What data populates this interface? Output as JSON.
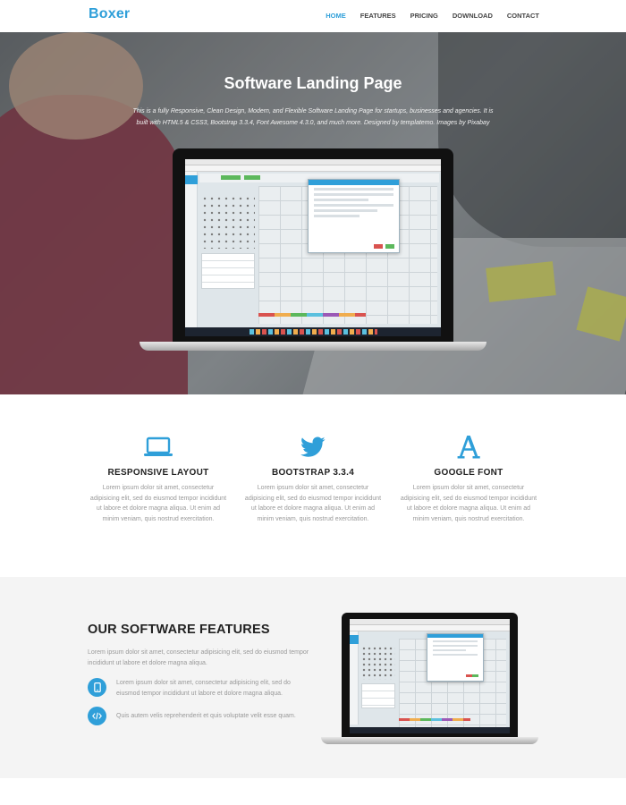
{
  "nav": {
    "brand": "Boxer",
    "links": [
      "HOME",
      "FEATURES",
      "PRICING",
      "DOWNLOAD",
      "CONTACT"
    ]
  },
  "hero": {
    "title": "Software Landing Page",
    "description": "This is a fully Responsive, Clean Design, Modern, and Flexible Software Landing Page for startups, businesses and agencies. It is built with HTML5 & CSS3, Bootstrap 3.3.4, Font Awesome 4.3.0, and much more. Designed by templatemo. Images by Pixabay"
  },
  "features": [
    {
      "icon": "laptop-icon",
      "title": "RESPONSIVE LAYOUT",
      "text": "Lorem ipsum dolor sit amet, consectetur adipisicing elit, sed do eiusmod tempor incididunt ut labore et dolore magna aliqua. Ut enim ad minim veniam, quis nostrud exercitation."
    },
    {
      "icon": "twitter-icon",
      "title": "BOOTSTRAP 3.3.4",
      "text": "Lorem ipsum dolor sit amet, consectetur adipisicing elit, sed do eiusmod tempor incididunt ut labore et dolore magna aliqua. Ut enim ad minim veniam, quis nostrud exercitation."
    },
    {
      "icon": "font-icon",
      "title": "GOOGLE FONT",
      "text": "Lorem ipsum dolor sit amet, consectetur adipisicing elit, sed do eiusmod tempor incididunt ut labore et dolore magna aliqua. Ut enim ad minim veniam, quis nostrud exercitation."
    }
  ],
  "software": {
    "title": "OUR SOFTWARE FEATURES",
    "intro": "Lorem ipsum dolor sit amet, consectetur adipisicing elit, sed do eiusmod tempor incididunt ut labore et dolore magna aliqua.",
    "items": [
      {
        "icon": "mobile-icon",
        "text": "Lorem ipsum dolor sit amet, consectetur adipisicing elit, sed do eiusmod tempor incididunt ut labore et dolore magna aliqua."
      },
      {
        "icon": "code-icon",
        "text": "Quis autem velis reprehenderit et quis voluptate velit esse quam."
      }
    ]
  },
  "colors": {
    "accent": "#2f9fd9",
    "heading": "#222222",
    "body_text": "#999999",
    "section_bg": "#f4f4f4"
  }
}
